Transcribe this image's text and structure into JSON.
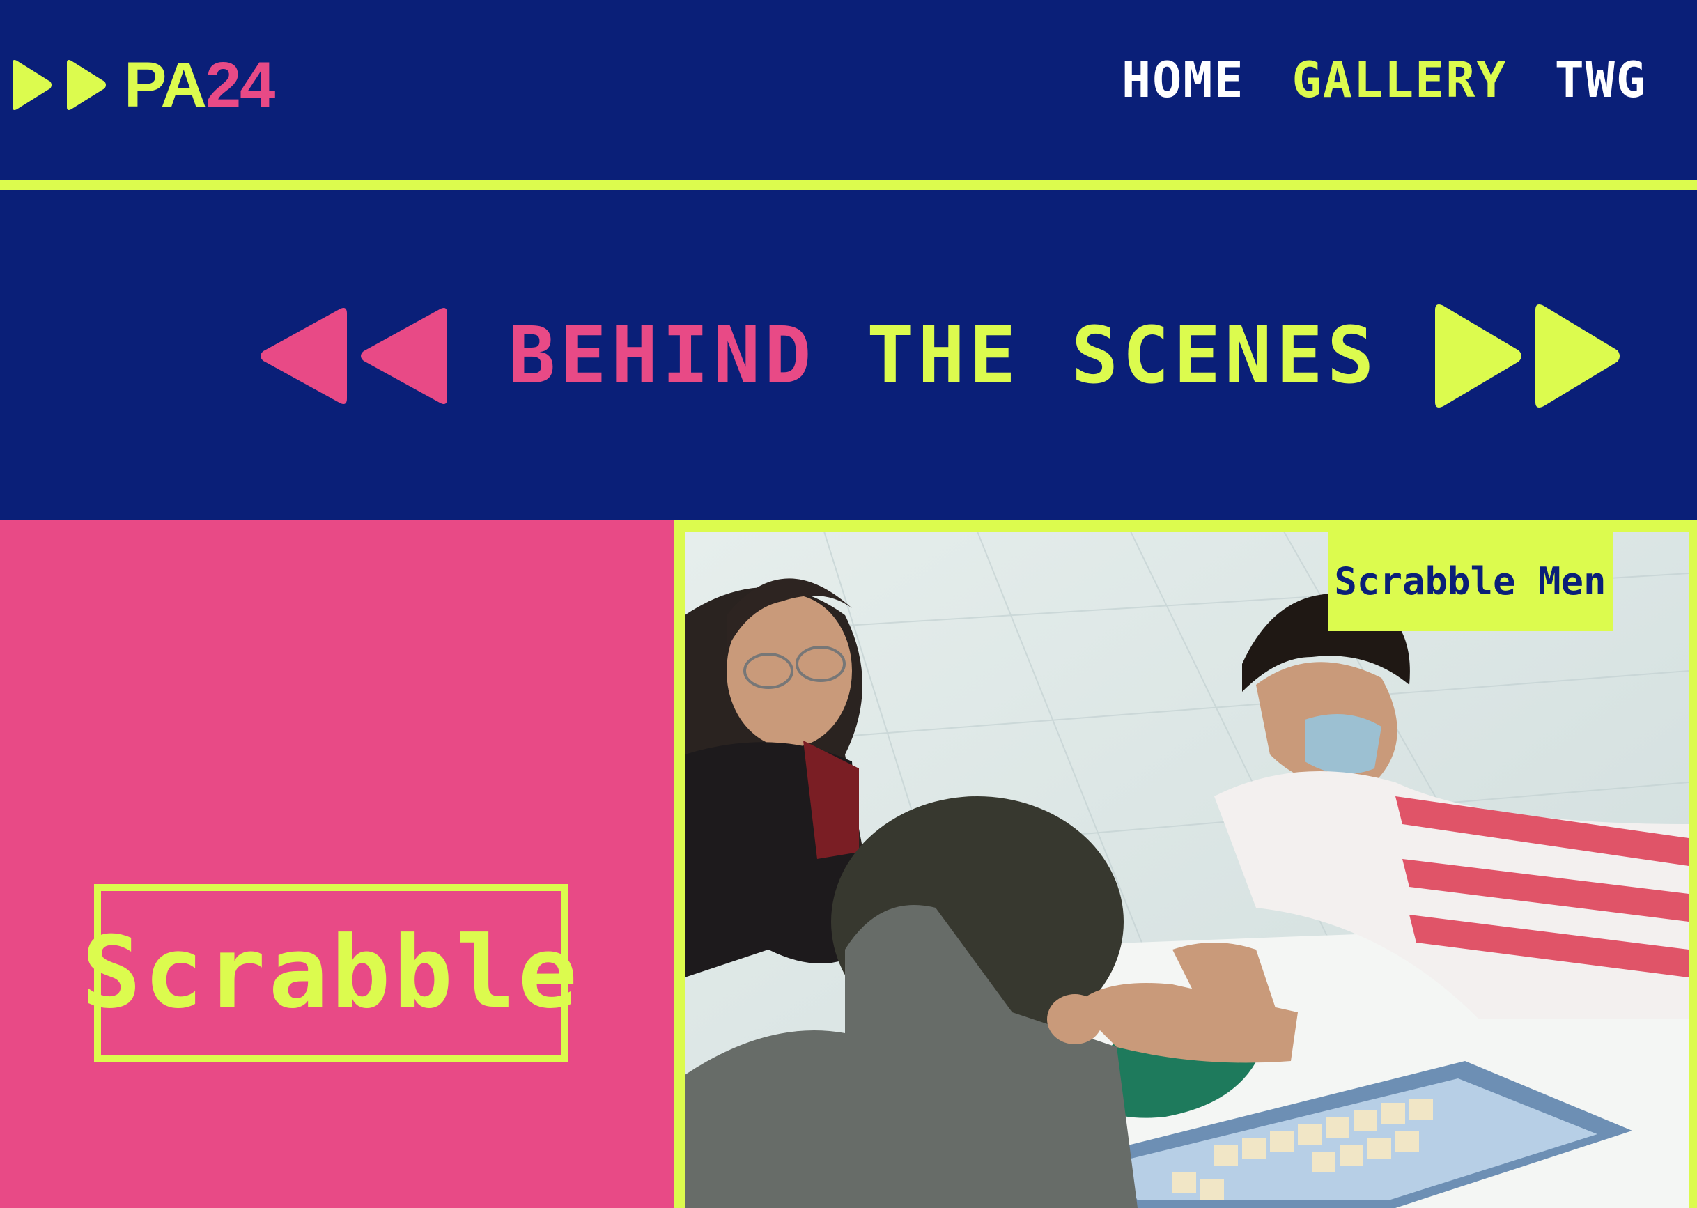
{
  "header": {
    "logo": {
      "prefix": "PA",
      "number": "24"
    },
    "nav": [
      {
        "label": "HOME",
        "active": false
      },
      {
        "label": "GALLERY",
        "active": true
      },
      {
        "label": "TWG",
        "active": false
      }
    ]
  },
  "hero": {
    "title_part1": "BEHIND",
    "title_part2": "THE SCENES"
  },
  "gallery": {
    "category": "Scrabble",
    "photo_tag": "Scrabble Men"
  },
  "colors": {
    "navy": "#0a1f78",
    "lime": "#dcfb4e",
    "pink": "#e84a86"
  },
  "icons": {
    "logo": "fast-forward-icon",
    "hero_left": "rewind-icon",
    "hero_right": "fast-forward-icon"
  }
}
